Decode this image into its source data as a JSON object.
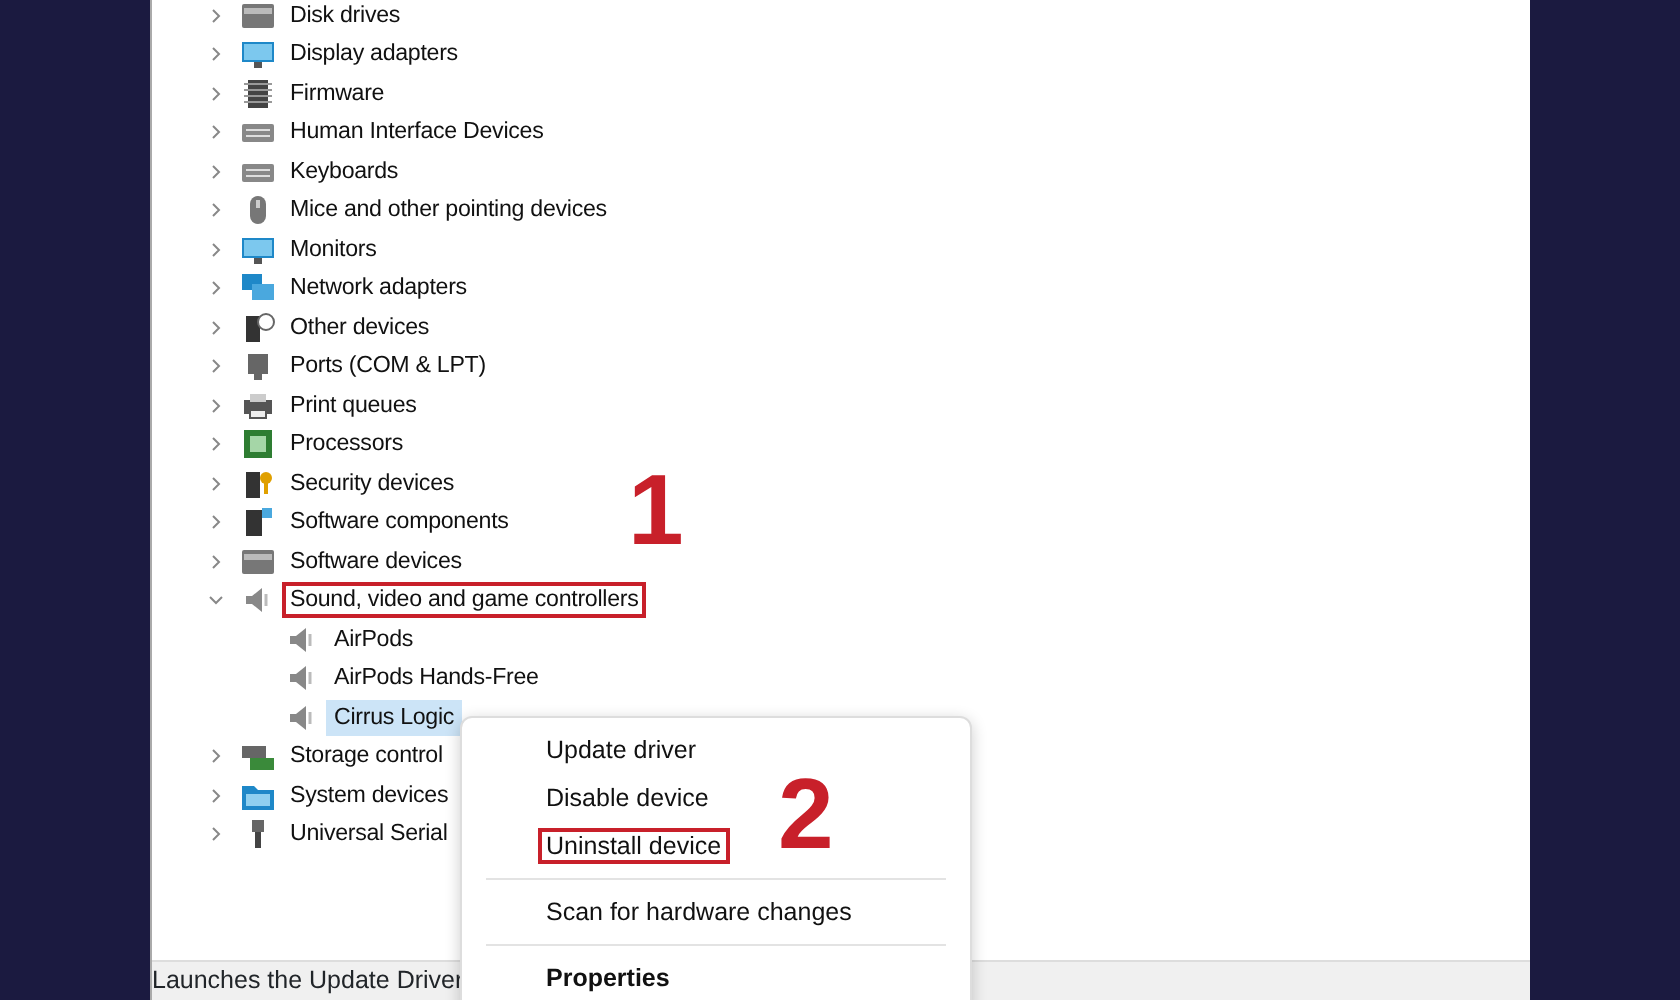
{
  "tree": [
    {
      "label": "Disk drives",
      "expanded": false
    },
    {
      "label": "Display adapters",
      "expanded": false
    },
    {
      "label": "Firmware",
      "expanded": false
    },
    {
      "label": "Human Interface Devices",
      "expanded": false
    },
    {
      "label": "Keyboards",
      "expanded": false
    },
    {
      "label": "Mice and other pointing devices",
      "expanded": false
    },
    {
      "label": "Monitors",
      "expanded": false
    },
    {
      "label": "Network adapters",
      "expanded": false
    },
    {
      "label": "Other devices",
      "expanded": false
    },
    {
      "label": "Ports (COM & LPT)",
      "expanded": false
    },
    {
      "label": "Print queues",
      "expanded": false
    },
    {
      "label": "Processors",
      "expanded": false
    },
    {
      "label": "Security devices",
      "expanded": false
    },
    {
      "label": "Software components",
      "expanded": false
    },
    {
      "label": "Software devices",
      "expanded": false
    },
    {
      "label": "Sound, video and game controllers",
      "expanded": true,
      "outlined": true,
      "children": [
        {
          "label": "AirPods",
          "selected": false
        },
        {
          "label": "AirPods Hands-Free",
          "selected": false
        },
        {
          "label": "Cirrus Logic",
          "selected": true
        }
      ]
    },
    {
      "label": "Storage control",
      "expanded": false
    },
    {
      "label": "System devices",
      "expanded": false
    },
    {
      "label": "Universal Serial",
      "expanded": false
    }
  ],
  "context_menu": [
    {
      "label": "Update driver",
      "kind": "item",
      "outlined": false
    },
    {
      "label": "Disable device",
      "kind": "item",
      "outlined": false
    },
    {
      "label": "Uninstall device",
      "kind": "item",
      "outlined": true
    },
    {
      "kind": "separator"
    },
    {
      "label": "Scan for hardware changes",
      "kind": "item",
      "outlined": false
    },
    {
      "kind": "separator"
    },
    {
      "label": "Properties",
      "kind": "default",
      "outlined": false
    }
  ],
  "status_bar": "Launches the Update Driver",
  "step_numbers": [
    "1",
    "2"
  ]
}
